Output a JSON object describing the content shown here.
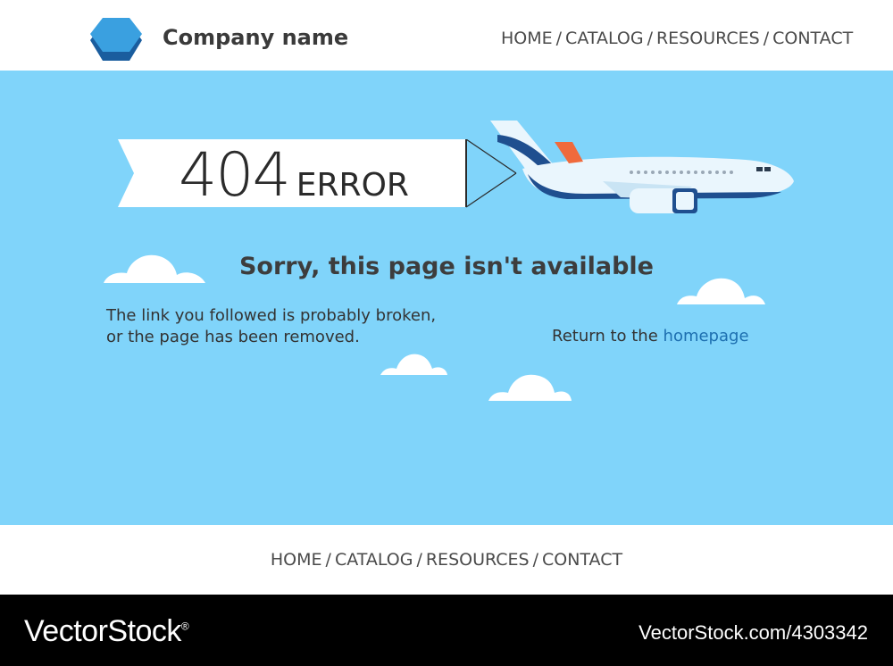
{
  "header": {
    "company_name": "Company name",
    "logo_icon": "hexagon-logo-icon",
    "nav": [
      "HOME",
      "CATALOG",
      "RESOURCES",
      "CONTACT"
    ],
    "separator": "/"
  },
  "banner": {
    "code": "404",
    "word": "ERROR"
  },
  "message": {
    "headline": "Sorry, this page isn't available",
    "line1": "The link you followed is probably broken,",
    "line2": "or the page has been removed.",
    "return_prefix": "Return to the",
    "return_link": "homepage"
  },
  "footer": {
    "nav": [
      "HOME",
      "CATALOG",
      "RESOURCES",
      "CONTACT"
    ],
    "separator": "/"
  },
  "watermark": {
    "brand": "VectorStock",
    "brand_mark": "®",
    "id_text": "VectorStock.com/4303342"
  },
  "colors": {
    "sky": "#80d4fa",
    "logo_light": "#3aa0e0",
    "logo_dark": "#1a5d9e",
    "link": "#1d6fb0",
    "plane_stripe": "#1f4f8f",
    "plane_tail": "#f06a3c"
  }
}
